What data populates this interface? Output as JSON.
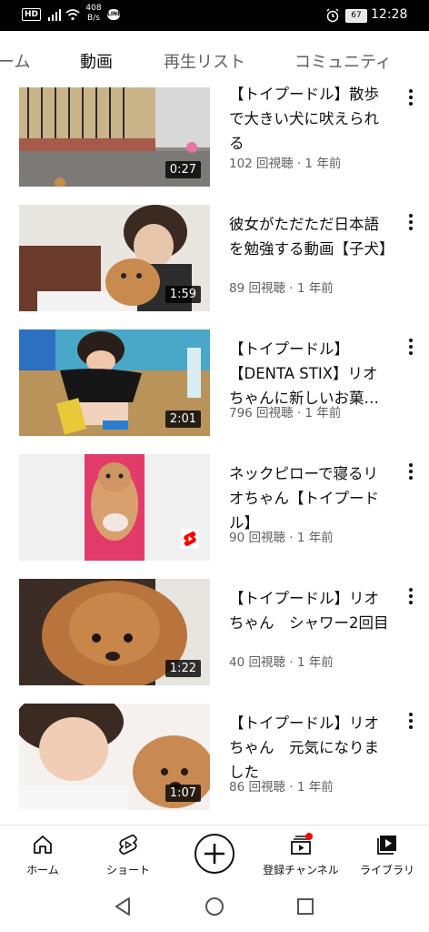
{
  "status_bar": {
    "badge": "HD",
    "speed_value": "408",
    "speed_unit": "B/s",
    "battery": "67",
    "time": "12:28"
  },
  "tabs": [
    {
      "label": "ーム",
      "active": false
    },
    {
      "label": "動画",
      "active": true
    },
    {
      "label": "再生リスト",
      "active": false
    },
    {
      "label": "コミュニティ",
      "active": false
    }
  ],
  "videos": [
    {
      "title": "【トイプードル】散歩で大きい犬に吠えられる",
      "meta": "102 回視聴 · 1 年前",
      "duration": "0:27"
    },
    {
      "title": "彼女がただただ日本語を勉強する動画【子犬】",
      "meta": "89 回視聴 · 1 年前",
      "duration": "1:59"
    },
    {
      "title": "【トイプードル】【DENTA STIX】リオちゃんに新しいお菓…",
      "meta": "796 回視聴 · 1 年前",
      "duration": "2:01"
    },
    {
      "title": "ネックピローで寝るリオちゃん【トイプードル】",
      "meta": "90 回視聴 · 1 年前",
      "duration": ""
    },
    {
      "title": "【トイプードル】リオちゃん　シャワー2回目",
      "meta": "40 回視聴 · 1 年前",
      "duration": "1:22"
    },
    {
      "title": "【トイプードル】リオちゃん　元気になりました",
      "meta": "86 回視聴 · 1 年前",
      "duration": "1:07"
    }
  ],
  "bottom_nav": {
    "home": "ホーム",
    "shorts": "ショート",
    "subscriptions": "登録チャンネル",
    "library": "ライブラリ"
  },
  "colors": {
    "accent": "#ff0000",
    "text_primary": "#0f0f0f",
    "text_secondary": "#606060"
  }
}
